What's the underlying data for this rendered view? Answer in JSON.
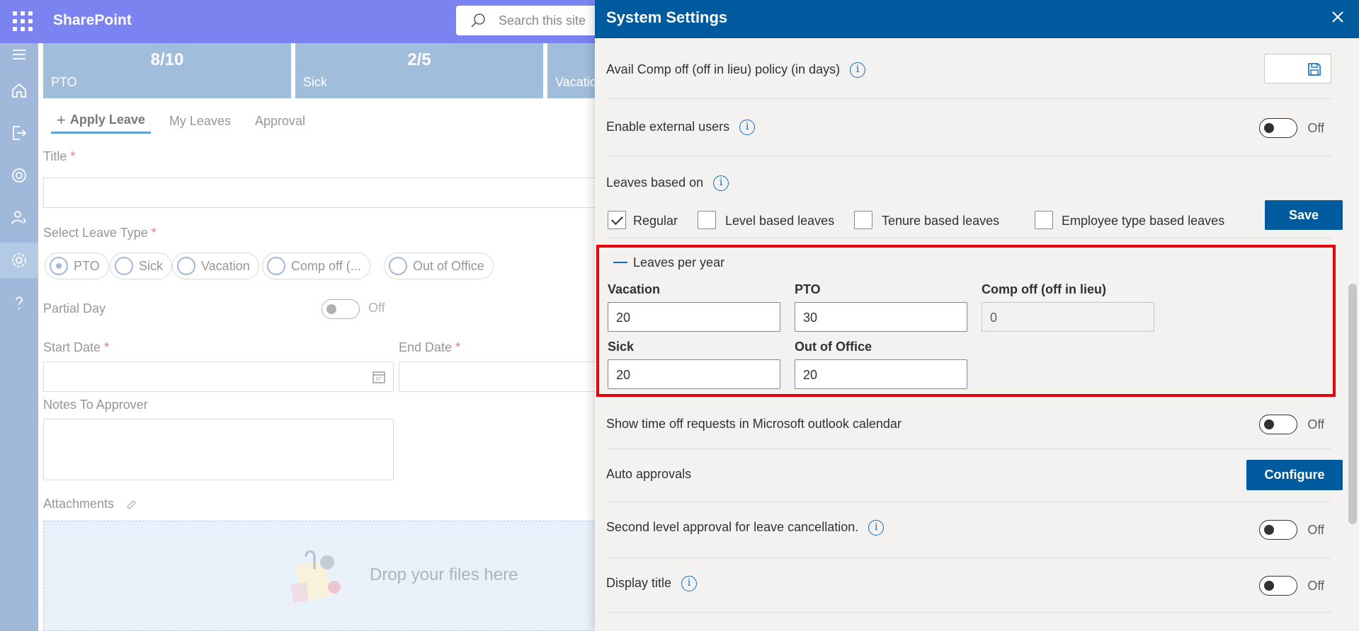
{
  "suitebar": {
    "brand": "SharePoint",
    "search_placeholder": "Search this site"
  },
  "tiles": [
    {
      "value": "8/10",
      "label": "PTO"
    },
    {
      "value": "2/5",
      "label": "Sick"
    },
    {
      "value": "",
      "label": "Vacatio"
    }
  ],
  "tabs": {
    "apply": "Apply Leave",
    "my": "My Leaves",
    "approval": "Approval"
  },
  "form": {
    "title_label": "Title",
    "leave_type_label": "Select Leave Type",
    "leave_types": [
      "PTO",
      "Sick",
      "Vacation",
      "Comp off (...",
      "Out of Office"
    ],
    "partial_day_label": "Partial Day",
    "partial_day_state": "Off",
    "start_date_label": "Start Date",
    "end_date_label": "End Date",
    "notes_label": "Notes To Approver",
    "attachments_label": "Attachments",
    "drop_text": "Drop your files here",
    "required_mark": "*"
  },
  "panel": {
    "title": "System Settings",
    "comp_off_policy": "Avail Comp off (off in lieu) policy (in days)",
    "external_users": "Enable external users",
    "external_users_state": "Off",
    "leaves_based_on": "Leaves based on",
    "leave_basis_options": [
      {
        "label": "Regular",
        "checked": true
      },
      {
        "label": "Level based leaves",
        "checked": false
      },
      {
        "label": "Tenure based leaves",
        "checked": false
      },
      {
        "label": "Employee type based leaves",
        "checked": false
      }
    ],
    "save_label": "Save",
    "leaves_per_year": {
      "title": "Leaves per year",
      "vacation_label": "Vacation",
      "vacation_value": "20",
      "pto_label": "PTO",
      "pto_value": "30",
      "comp_off_label": "Comp off (off in lieu)",
      "comp_off_value": "0",
      "sick_label": "Sick",
      "sick_value": "20",
      "ooo_label": "Out of Office",
      "ooo_value": "20"
    },
    "outlook_calendar": "Show time off requests in Microsoft outlook calendar",
    "outlook_calendar_state": "Off",
    "auto_approvals": "Auto approvals",
    "configure_label": "Configure",
    "second_level": "Second level approval for leave cancellation.",
    "second_level_state": "Off",
    "display_title": "Display title",
    "display_title_state": "Off",
    "info_glyph": "i"
  },
  "colors": {
    "header": "#005a9e",
    "suitebar": "#7b83f0",
    "highlight": "#e8000b"
  }
}
